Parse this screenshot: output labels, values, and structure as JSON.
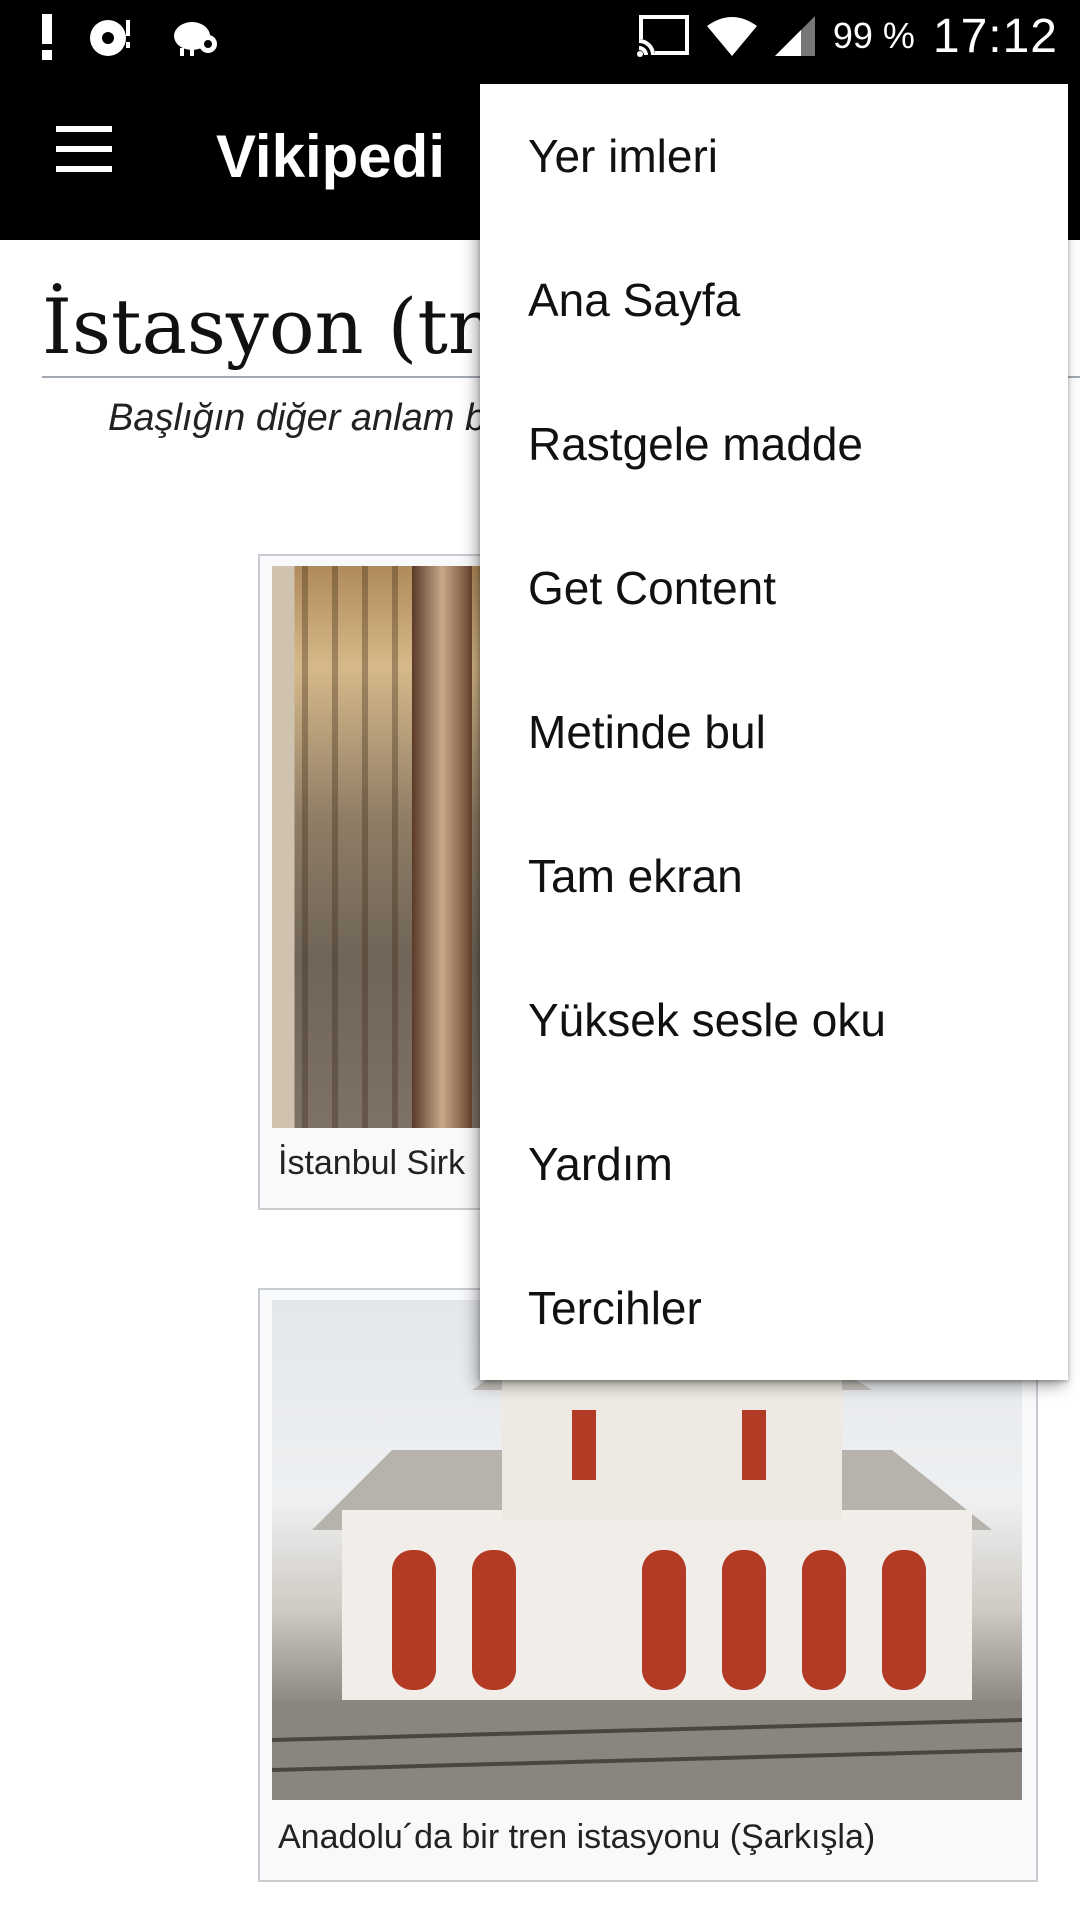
{
  "status_bar": {
    "icons_left": [
      "alert-icon",
      "music-disc-icon",
      "kiwi-bird-icon"
    ],
    "icons_right": [
      "cast-icon",
      "wifi-icon",
      "signal-icon"
    ],
    "battery_text": "99 %",
    "time": "17:12"
  },
  "app_bar": {
    "menu_icon": "hamburger-icon",
    "title": "Vikipedi"
  },
  "article": {
    "title": "İstasyon (tren",
    "hatnote": "Başlığın diğer anlam bakınız.",
    "figures": [
      {
        "caption": "İstanbul Sirk",
        "image": "railway-platform-photo"
      },
      {
        "caption": "Anadolu´da bir tren istasyonu (Şarkışla)",
        "image": "station-building-photo"
      }
    ]
  },
  "overflow_menu": {
    "items": [
      {
        "label": "Yer imleri"
      },
      {
        "label": "Ana Sayfa"
      },
      {
        "label": "Rastgele madde"
      },
      {
        "label": "Get Content"
      },
      {
        "label": "Metinde bul"
      },
      {
        "label": "Tam ekran"
      },
      {
        "label": "Yüksek sesle oku"
      },
      {
        "label": "Yardım"
      },
      {
        "label": "Tercihler"
      }
    ]
  },
  "colors": {
    "bar_background": "#000000",
    "menu_background": "#ffffff",
    "text": "#111111"
  }
}
